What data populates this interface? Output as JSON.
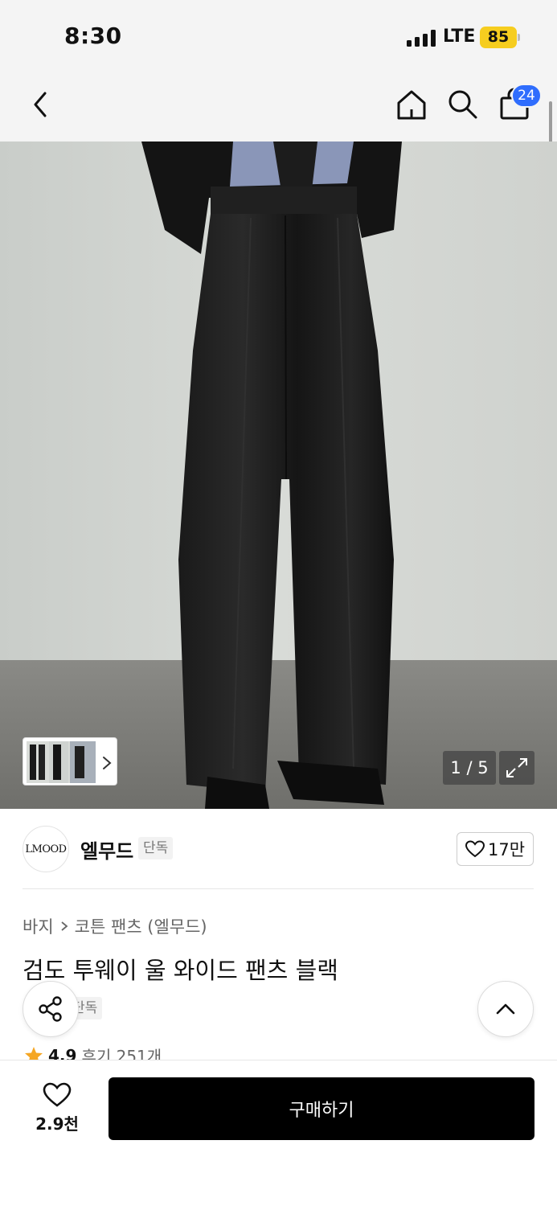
{
  "status_bar": {
    "time": "8:30",
    "network": "LTE",
    "battery": "85"
  },
  "nav": {
    "back_icon": "chevron-left-icon",
    "home_icon": "home-icon",
    "search_icon": "search-icon",
    "cart_icon": "shopping-bag-icon",
    "cart_count": "24"
  },
  "gallery": {
    "counter": "1 / 5",
    "expand_icon": "expand-icon",
    "thumbnails_icon": "chevron-right-icon",
    "current_index": 1,
    "total": 5
  },
  "brand": {
    "logo_text": "LMOOD",
    "name": "엘무드",
    "tag": "단독",
    "like_count": "17만"
  },
  "product": {
    "breadcrumb": [
      "바지",
      "코튼 팬츠 (엘무드)"
    ],
    "title": "검도 투웨이 울 와이드 팬츠 블랙",
    "tag": "단독",
    "rating": "4.9",
    "reviews": "후기 251개"
  },
  "actions": {
    "share_icon": "share-icon",
    "scroll_top_icon": "chevron-up-icon",
    "wish_icon": "heart-icon",
    "wish_count": "2.9천",
    "buy_label": "구매하기"
  },
  "colors": {
    "accent_badge": "#2f6dfd",
    "battery": "#f6cd1f",
    "buy_button": "#000000",
    "star": "#f5a623"
  }
}
